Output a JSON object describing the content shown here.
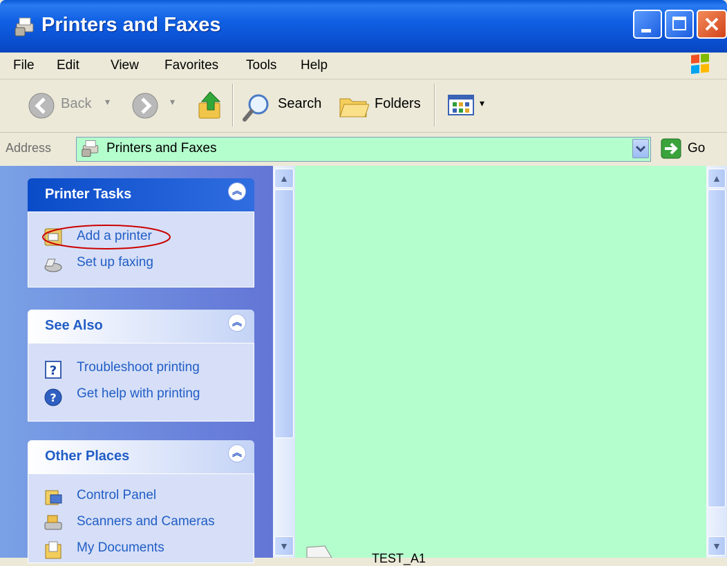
{
  "window": {
    "title": "Printers and Faxes"
  },
  "menu": {
    "items": [
      "File",
      "Edit",
      "View",
      "Favorites",
      "Tools",
      "Help"
    ]
  },
  "toolbar": {
    "back_label": "Back",
    "search_label": "Search",
    "folders_label": "Folders"
  },
  "address": {
    "label": "Address",
    "value": "Printers and Faxes",
    "go_label": "Go"
  },
  "panels": [
    {
      "title": "Printer Tasks",
      "items": [
        {
          "label": "Add a printer",
          "icon": "add-printer-icon"
        },
        {
          "label": "Set up faxing",
          "icon": "fax-icon"
        }
      ]
    },
    {
      "title": "See Also",
      "items": [
        {
          "label": "Troubleshoot printing",
          "icon": "troubleshoot-icon"
        },
        {
          "label": "Get help with printing",
          "icon": "help-icon"
        }
      ]
    },
    {
      "title": "Other Places",
      "items": [
        {
          "label": "Control Panel",
          "icon": "control-panel-icon"
        },
        {
          "label": "Scanners and Cameras",
          "icon": "scanner-icon"
        },
        {
          "label": "My Documents",
          "icon": "documents-icon"
        }
      ]
    }
  ],
  "main": {
    "partial_item_label": "TEST_A1"
  },
  "colors": {
    "content_bg": "#b4fecd",
    "title_bar": "#0a5ad9",
    "link": "#215dc6",
    "panel_header_text": "#215dc6",
    "highlight_ellipse": "#cc0000"
  }
}
